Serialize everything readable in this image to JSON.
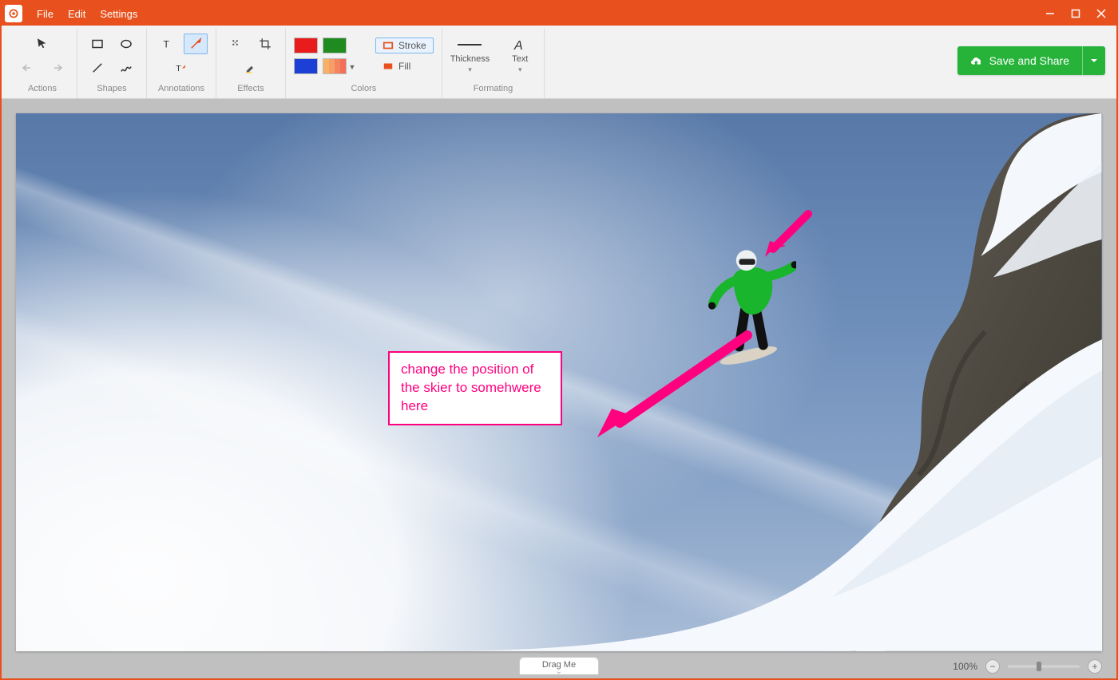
{
  "menus": {
    "file": "File",
    "edit": "Edit",
    "settings": "Settings"
  },
  "ribbon": {
    "actions_label": "Actions",
    "shapes_label": "Shapes",
    "annotations_label": "Annotations",
    "effects_label": "Effects",
    "colors_label": "Colors",
    "formatting_label": "Formating",
    "stroke_label": "Stroke",
    "fill_label": "Fill",
    "thickness_label": "Thickness",
    "text_label": "Text",
    "colors": {
      "red": "#e81c1c",
      "green": "#1f8a1f",
      "blue": "#1c3fd6"
    }
  },
  "save_button": "Save and Share",
  "annotation_text": "change the position of the skier to somehwere here",
  "footer": {
    "drag": "Drag Me",
    "zoom": "100%"
  }
}
